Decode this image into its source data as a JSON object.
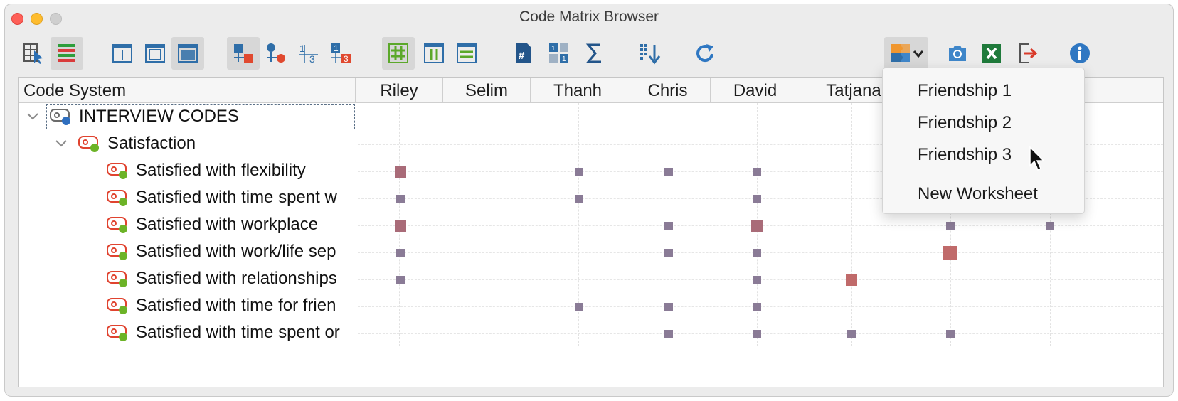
{
  "window": {
    "title": "Code Matrix Browser"
  },
  "toolbar": {
    "buttons": [
      {
        "name": "select-docs-icon",
        "active": false
      },
      {
        "name": "coding-colors-icon",
        "active": true
      },
      {
        "name": "view-frame-1-icon",
        "active": false
      },
      {
        "name": "view-frame-2-icon",
        "active": false
      },
      {
        "name": "view-frame-3-icon",
        "active": true
      },
      {
        "name": "symbol-squares-icon",
        "active": true
      },
      {
        "name": "symbol-circles-icon",
        "active": false
      },
      {
        "name": "numbers-icon",
        "active": false
      },
      {
        "name": "numbers-highlight-icon",
        "active": false
      },
      {
        "name": "grid-icon",
        "active": true
      },
      {
        "name": "columns-icon",
        "active": false
      },
      {
        "name": "rows-icon",
        "active": false
      },
      {
        "name": "document-hash-icon",
        "active": false
      },
      {
        "name": "blocks-icon",
        "active": false
      },
      {
        "name": "sigma-icon",
        "active": false
      },
      {
        "name": "sort-icon",
        "active": false
      },
      {
        "name": "refresh-icon",
        "active": false
      },
      {
        "name": "puzzle-dropdown-icon",
        "active": true
      },
      {
        "name": "camera-icon",
        "active": false
      },
      {
        "name": "excel-icon",
        "active": false
      },
      {
        "name": "export-icon",
        "active": false
      },
      {
        "name": "info-icon",
        "active": false
      }
    ]
  },
  "matrix": {
    "header_first": "Code System",
    "columns": [
      "Riley",
      "Selim",
      "Thanh",
      "Chris",
      "David",
      "Tatjana"
    ],
    "root_label": "INTERVIEW CODES",
    "group_label": "Satisfaction",
    "rows": [
      {
        "label": "Satisfied with flexibility"
      },
      {
        "label": "Satisfied with time spent w"
      },
      {
        "label": "Satisfied with workplace"
      },
      {
        "label": "Satisfied with work/life sep"
      },
      {
        "label": "Satisfied with relationships"
      },
      {
        "label": "Satisfied with time for frien"
      },
      {
        "label": "Satisfied with time spent or"
      }
    ],
    "colors": {
      "small_square": "#8a7b96",
      "large_square": "#a96b78",
      "red_square": "#c06a6a"
    }
  },
  "dropdown": {
    "items": [
      "Friendship 1",
      "Friendship 2",
      "Friendship 3"
    ],
    "extra_item": "New Worksheet"
  }
}
